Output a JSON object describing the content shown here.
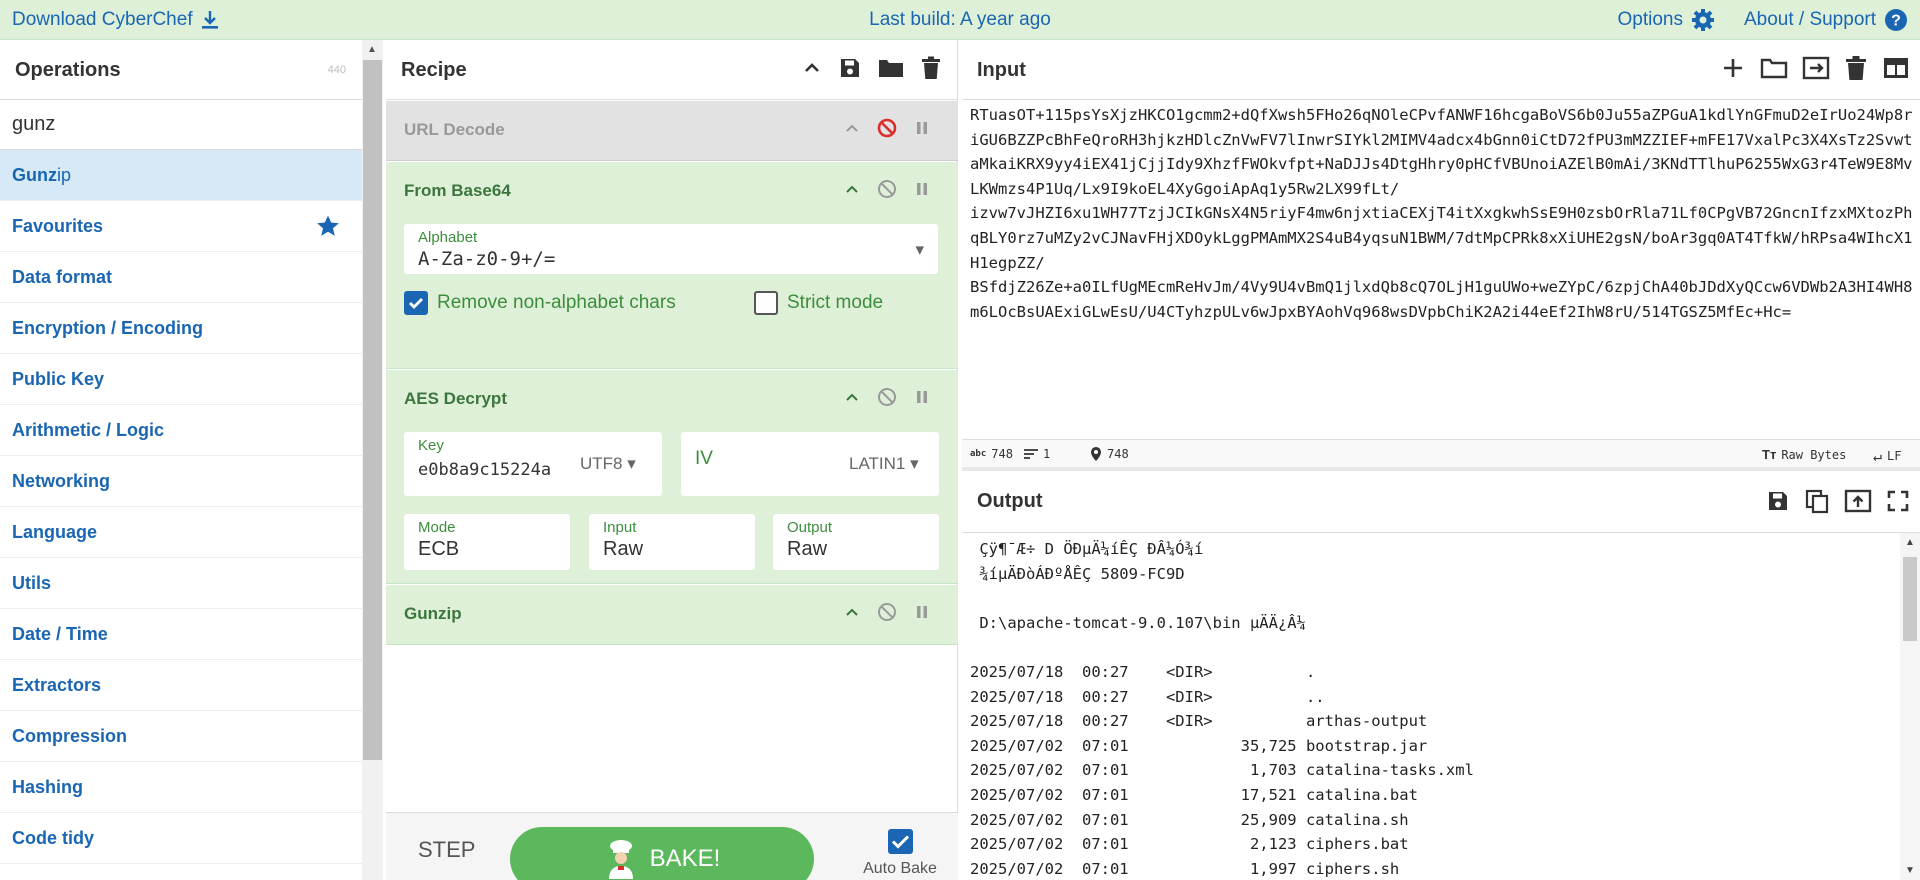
{
  "banner": {
    "download_label": "Download CyberChef",
    "build_label": "Last build: A year ago",
    "options_label": "Options",
    "about_label": "About / Support"
  },
  "operations": {
    "title": "Operations",
    "count": "440",
    "search_value": "gunz",
    "result": {
      "match": "Gunz",
      "rest": "ip"
    },
    "categories": [
      "Favourites",
      "Data format",
      "Encryption / Encoding",
      "Public Key",
      "Arithmetic / Logic",
      "Networking",
      "Language",
      "Utils",
      "Date / Time",
      "Extractors",
      "Compression",
      "Hashing",
      "Code tidy"
    ]
  },
  "recipe": {
    "title": "Recipe",
    "ops": [
      {
        "name": "URL Decode",
        "disabled": true
      },
      {
        "name": "From Base64",
        "alphabet_label": "Alphabet",
        "alphabet_value": "A-Za-z0-9+/=",
        "remove_label": "Remove non-alphabet chars",
        "remove_checked": true,
        "strict_label": "Strict mode",
        "strict_checked": false
      },
      {
        "name": "AES Decrypt",
        "key_label": "Key",
        "key_value": "e0b8a9c15224a",
        "key_encoding": "UTF8",
        "iv_label": "IV",
        "iv_value": "",
        "iv_encoding": "LATIN1",
        "mode_label": "Mode",
        "mode_value": "ECB",
        "input_label": "Input",
        "input_value": "Raw",
        "output_label": "Output",
        "output_value": "Raw"
      },
      {
        "name": "Gunzip"
      }
    ],
    "step_label": "STEP",
    "bake_label": "BAKE!",
    "autobake_label": "Auto Bake",
    "autobake_checked": true
  },
  "input": {
    "title": "Input",
    "text": "RTuasOT+115psYsXjzHKCO1gcmm2+dQfXwsh5FHo26qNOleCPvfANWF16hcgaBoVS6b0Ju55aZPGuA1kdlYnGFmuD2eIrUo24Wp8riGU6BZZPcBhFeQroRH3hjkzHDlcZnVwFV7lInwrSIYkl2MIMV4adcx4bGnn0iCtD72fPU3mMZZIEF+mFE17VxalPc3X4XsTz2SvwtaMkaiKRX9yy4iEX41jCjjIdy9XhzfFWOkvfpt+NaDJJs4DtgHhry0pHCfVBUnoiAZElB0mAi/3KNdTTlhuP6255WxG3r4TeW9E8MvLKWmzs4P1Uq/Lx9I9koEL4XyGgoiApAq1y5Rw2LX99fLt/\nizvw7vJHZI6xu1WH77TzjJCIkGNsX4N5riyF4mw6njxtiaCEXjT4itXxgkwhSsE9H0zsbOrRla71Lf0CPgVB72GncnIfzxMXtozPhqBLY0rz7uMZy2vCJNavFHjXDOykLggPMAmMX2S4uB4yqsuN1BWM/7dtMpCPRk8xXiUHE2gsN/boAr3gq0AT4TfkW/hRPsa4WIhcX1H1egpZZ/\nBSfdjZ26Ze+a0ILfUgMEcmReHvJm/4Vy9U4vBmQ1jlxdQb8cQ7OLjH1guUWo+weZYpC/6zpjChA40bJDdXyQCcw6VDWb2A3HI4WH8m6LOcBsUAExiGLwEsU/U4CTyhzpULv6wJpxBYAohVq968wsDVpbChiK2A2i44eEf2IhW8rU/514TGSZ5MfEc+Hc=",
    "stats": {
      "chars": "748",
      "lines": "1",
      "position": "748"
    },
    "raw_bytes_label": "Raw Bytes",
    "eol_label": "LF"
  },
  "output": {
    "title": "Output",
    "lines": [
      " Çÿ¶¯Æ÷ D ÖÐµÄ¼íÊÇ ÐÂ¼Ó¾í",
      " ¾íµÄÐòÁÐºÅÊÇ 5809-FC9D",
      "",
      " D:\\apache-tomcat-9.0.107\\bin µÄÄ¿Â¼",
      "",
      "2025/07/18  00:27    <DIR>          .",
      "2025/07/18  00:27    <DIR>          ..",
      "2025/07/18  00:27    <DIR>          arthas-output",
      "2025/07/02  07:01            35,725 bootstrap.jar",
      "2025/07/02  07:01             1,703 catalina-tasks.xml",
      "2025/07/02  07:01            17,521 catalina.bat",
      "2025/07/02  07:01            25,909 catalina.sh",
      "2025/07/02  07:01             2,123 ciphers.bat",
      "2025/07/02  07:01             1,997 ciphers.sh"
    ]
  },
  "colors": {
    "link": "#1a66b3",
    "op_green": "#3c763d",
    "card_bg": "#dff0d8",
    "bake": "#5cb85c",
    "disable_red": "#d9302c"
  }
}
